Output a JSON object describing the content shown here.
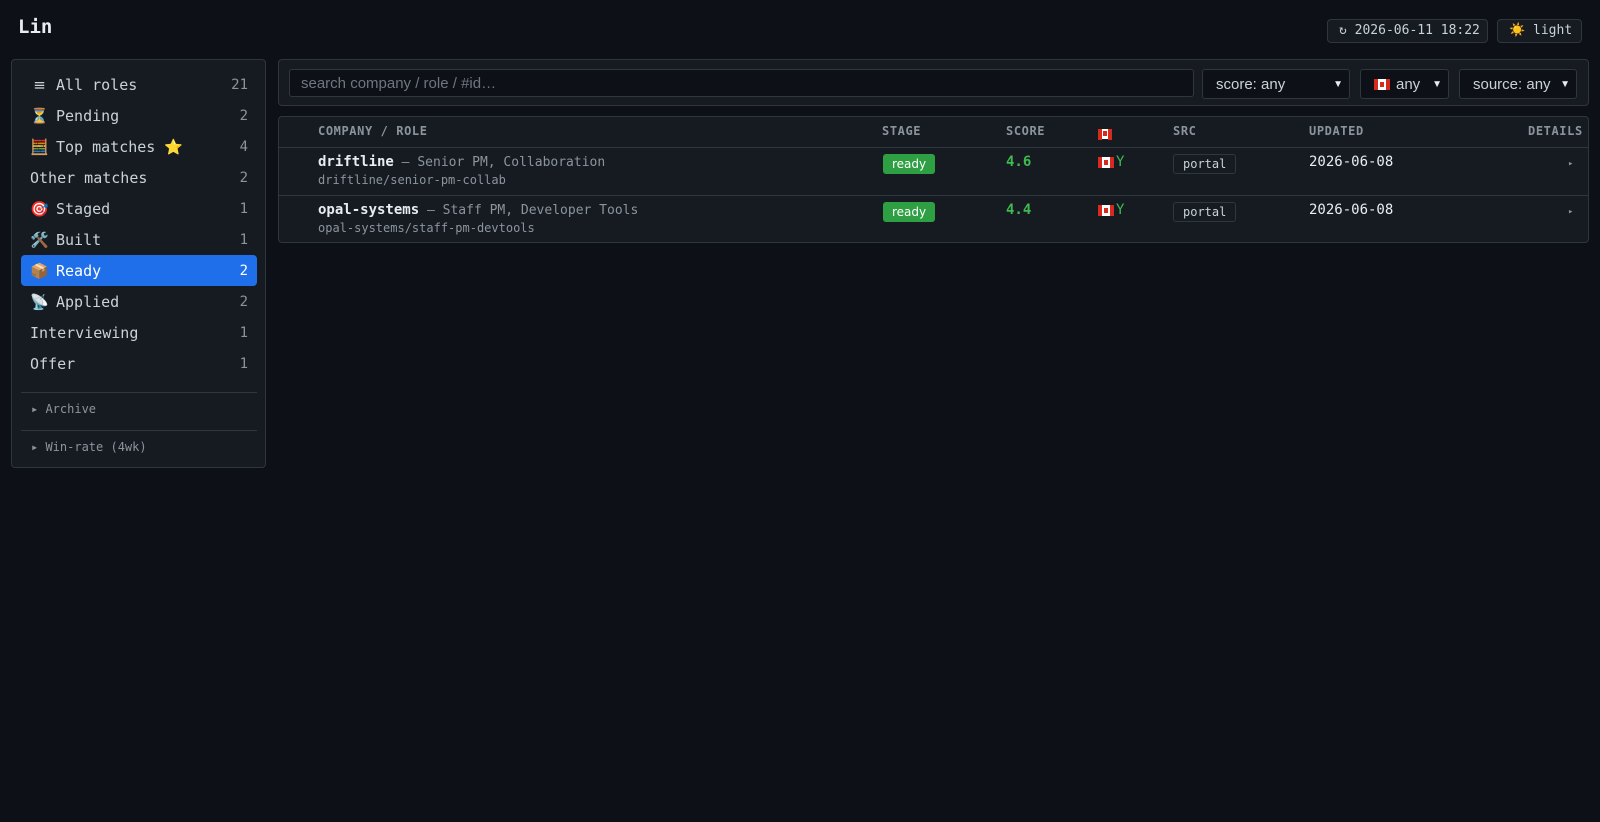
{
  "header": {
    "title": "Lin",
    "refresh_icon": "refresh-icon",
    "refresh_glyph": "↻",
    "refresh_label": "2026-06-11 18:22",
    "theme_glyph": "☀️",
    "theme_label": "light"
  },
  "sidebar": {
    "items": [
      {
        "icon": "list-icon",
        "glyph": "≡",
        "label": "All roles",
        "count": "21"
      },
      {
        "icon": "hourglass-icon",
        "glyph": "⏳",
        "label": "Pending",
        "count": "2"
      },
      {
        "icon": "abacus-icon",
        "glyph": "🧮",
        "label": "Top matches ⭐",
        "count": "4"
      },
      {
        "icon": "",
        "glyph": "",
        "label": "Other matches",
        "count": "2"
      },
      {
        "icon": "target-icon",
        "glyph": "🎯",
        "label": "Staged",
        "count": "1"
      },
      {
        "icon": "tools-icon",
        "glyph": "🛠️",
        "label": "Built",
        "count": "1"
      },
      {
        "icon": "package-icon",
        "glyph": "📦",
        "label": "Ready",
        "count": "2",
        "active": true
      },
      {
        "icon": "satellite-icon",
        "glyph": "📡",
        "label": "Applied",
        "count": "2"
      },
      {
        "icon": "",
        "glyph": "",
        "label": "Interviewing",
        "count": "1"
      },
      {
        "icon": "",
        "glyph": "",
        "label": "Offer",
        "count": "1"
      }
    ],
    "archive_label": "▸ Archive",
    "winrate_label": "▸ Win-rate (4wk)"
  },
  "filters": {
    "search_placeholder": "search company / role / #id…",
    "search_value": "",
    "score_value": "score: any",
    "visa_value": "any",
    "source_value": "source: any"
  },
  "table": {
    "headers": {
      "company_role": "COMPANY / ROLE",
      "stage": "STAGE",
      "score": "SCORE",
      "src": "SRC",
      "updated": "UPDATED",
      "details": "DETAILS"
    },
    "rows": [
      {
        "company": "driftline",
        "role": " — Senior PM, Collaboration",
        "slug": "driftline/senior-pm-collab",
        "stage": "ready",
        "score": "4.6",
        "visa": "Y",
        "src": "portal",
        "updated": "2026-06-08",
        "details": "▸"
      },
      {
        "company": "opal-systems",
        "role": " — Staff PM, Developer Tools",
        "slug": "opal-systems/staff-pm-devtools",
        "stage": "ready",
        "score": "4.4",
        "visa": "Y",
        "src": "portal",
        "updated": "2026-06-08",
        "details": "▸"
      }
    ]
  },
  "colors": {
    "background": "#0d1117",
    "accent": "#1f6feb",
    "success": "#2ea043",
    "score": "#3fb950"
  }
}
